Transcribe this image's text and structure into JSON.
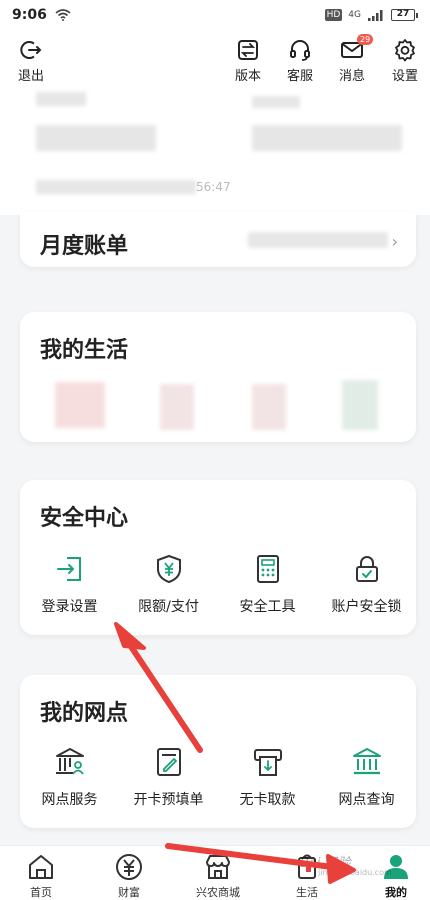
{
  "status_bar": {
    "time": "9:06",
    "hd": "HD",
    "network": "4G",
    "battery": "27"
  },
  "header": {
    "exit_label": "退出",
    "version_label": "版本",
    "service_label": "客服",
    "message_label": "消息",
    "message_badge": "29",
    "settings_label": "设置"
  },
  "profile": {
    "time_fragment": "56:47"
  },
  "monthly_bill": {
    "title": "月度账单",
    "chevron": "›"
  },
  "my_life": {
    "title": "我的生活"
  },
  "security_center": {
    "title": "安全中心",
    "items": [
      {
        "label": "登录设置",
        "icon": "login-icon"
      },
      {
        "label": "限额/支付",
        "icon": "shield-yen-icon"
      },
      {
        "label": "安全工具",
        "icon": "calculator-icon"
      },
      {
        "label": "账户安全锁",
        "icon": "lock-icon"
      }
    ]
  },
  "my_branch": {
    "title": "我的网点",
    "items": [
      {
        "label": "网点服务",
        "icon": "bank-person-icon"
      },
      {
        "label": "开卡预填单",
        "icon": "form-edit-icon"
      },
      {
        "label": "无卡取款",
        "icon": "atm-icon"
      },
      {
        "label": "网点查询",
        "icon": "bank-icon"
      }
    ]
  },
  "bottom_nav": [
    {
      "label": "首页",
      "icon": "home-icon"
    },
    {
      "label": "财富",
      "icon": "yen-icon"
    },
    {
      "label": "兴农商城",
      "icon": "shop-icon"
    },
    {
      "label": "生活",
      "icon": "life-icon"
    },
    {
      "label": "我的",
      "icon": "user-icon"
    }
  ],
  "watermark": {
    "text": "Bai 经验",
    "sub": "jingyan.baidu.com"
  },
  "colors": {
    "accent": "#1aa37a",
    "arrow": "#e8403a",
    "badge": "#f05b4f"
  }
}
